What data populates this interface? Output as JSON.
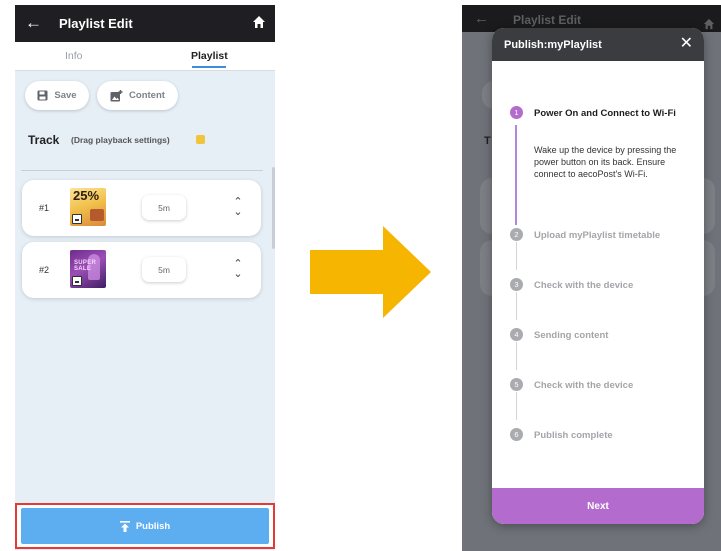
{
  "left": {
    "appbar": {
      "title": "Playlist Edit"
    },
    "tabs": [
      {
        "label": "Info"
      },
      {
        "label": "Playlist"
      }
    ],
    "toolbar": {
      "save_label": "Save",
      "content_label": "Content"
    },
    "track": {
      "title": "Track",
      "subtitle": "(Drag playback settings)"
    },
    "rows": [
      {
        "number": "#1",
        "thumb_text": "25%",
        "duration": "5m"
      },
      {
        "number": "#2",
        "thumb_text": "SUPER SALE",
        "duration": "5m"
      }
    ],
    "publish_label": "Publish"
  },
  "right": {
    "appbar": {
      "title": "Playlist Edit"
    },
    "background_letter": "T",
    "dialog": {
      "title": "Publish:myPlaylist",
      "steps": [
        {
          "number": "1",
          "label": "Power On and Connect to Wi-Fi",
          "description": "Wake up the device by pressing the power button on its back. Ensure connect to aecoPost's Wi-Fi."
        },
        {
          "number": "2",
          "label": "Upload myPlaylist timetable"
        },
        {
          "number": "3",
          "label": "Check with the device"
        },
        {
          "number": "4",
          "label": "Sending content"
        },
        {
          "number": "5",
          "label": "Check with the device"
        },
        {
          "number": "6",
          "label": "Publish complete"
        }
      ],
      "next_label": "Next"
    }
  },
  "colors": {
    "appbar": "#1f1f23",
    "tab_accent": "#3e8ede",
    "publish_button": "#5daef0",
    "highlight_border": "#e53935",
    "arrow": "#f5b500",
    "step_active": "#b36ccd",
    "next_button": "#b36ccd"
  },
  "icons": {
    "back": "arrow-left-icon",
    "home": "home-icon",
    "save": "floppy-disk-icon",
    "content": "add-image-icon",
    "reorder": "chevron-up-down-icon",
    "publish": "upload-icon",
    "close": "close-icon"
  }
}
